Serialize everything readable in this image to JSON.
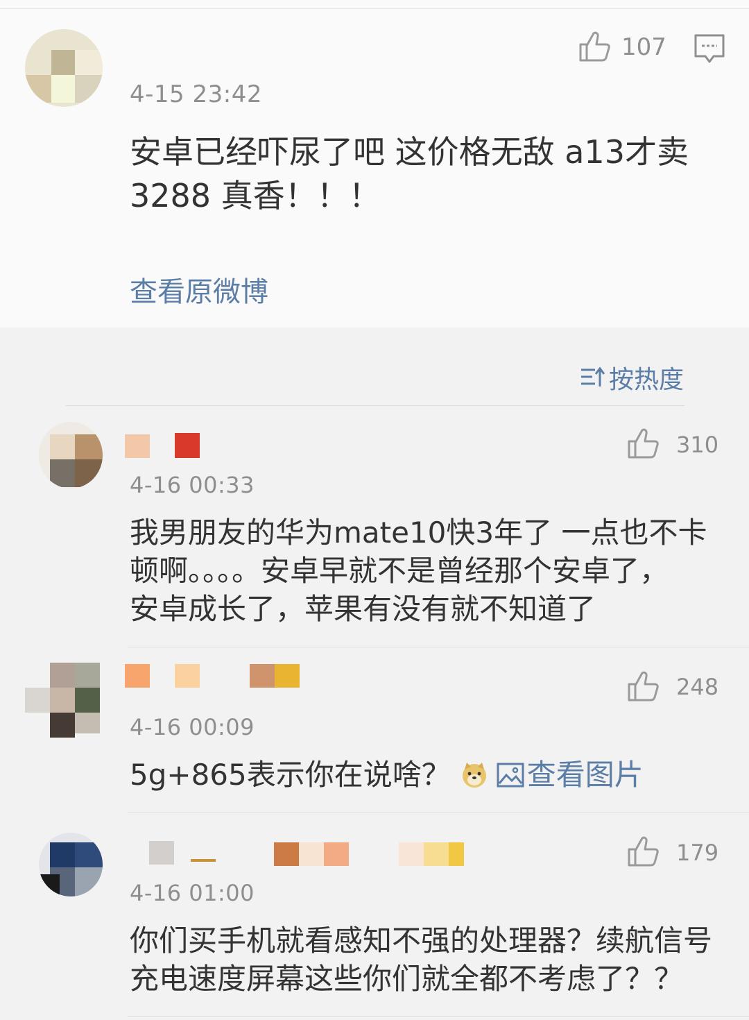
{
  "original": {
    "time": "4-15 23:42",
    "likes": "107",
    "text_line1": "安卓已经吓尿了吧 这价格无敌 a13才卖",
    "text_line2": "3288 真香！！！",
    "view_original": "查看原微博"
  },
  "sort": {
    "label": "按热度"
  },
  "comments": [
    {
      "time": "4-16 00:33",
      "likes": "310",
      "lines": [
        "我男朋友的华为mate10快3年了 一点也不卡",
        "顿啊。。。。安卓早就不是曾经那个安卓了，",
        "安卓成长了，苹果有没有就不知道了"
      ]
    },
    {
      "time": "4-16 00:09",
      "likes": "248",
      "text": "5g+865表示你在说啥？",
      "view_image": "查看图片"
    },
    {
      "time": "4-16 01:00",
      "likes": "179",
      "lines": [
        "你们买手机就看感知不强的处理器？续航信号",
        "充电速度屏幕这些你们就全都不考虑了？？"
      ]
    }
  ],
  "colors": {
    "link": "#5b7da6",
    "muted": "#8e8e8e",
    "text": "#333333"
  }
}
